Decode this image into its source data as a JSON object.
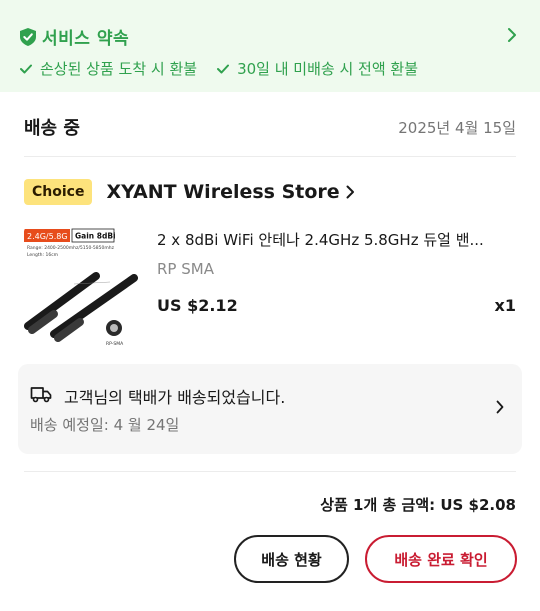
{
  "promise": {
    "title": "서비스 약속",
    "items": [
      "손상된 상품 도착 시 환불",
      "30일 내 미배송 시 전액 환불"
    ],
    "color": "#30a14e",
    "background": "#effaee"
  },
  "order": {
    "status": "배송 중",
    "date": "2025년 4월 15일"
  },
  "store": {
    "badge": "Choice",
    "name": "XYANT Wireless Store"
  },
  "product": {
    "image_labels": {
      "band": "2.4G/5.8G",
      "gain": "Gain 8dBi",
      "range": "Range: 2400-2500mhz/5150-5850mhz",
      "length": "Length: 16cm",
      "connector": "RP-SMA"
    },
    "name": "2 x 8dBi WiFi 안테나 2.4GHz 5.8GHz 듀얼 밴...",
    "variant": "RP SMA",
    "price": "US $2.12",
    "quantity": "x1"
  },
  "delivery": {
    "message": "고객님의 택배가 배송되었습니다.",
    "eta": "배송 예정일: 4 월 24일"
  },
  "summary": {
    "total": "상품 1개 총 금액: US $2.08"
  },
  "actions": {
    "track_label": "배송 현황",
    "confirm_label": "배송 완료 확인",
    "confirm_color": "#c91c32"
  },
  "icons": [
    "shield-check-icon",
    "chevron-right-icon",
    "check-icon",
    "truck-icon"
  ]
}
